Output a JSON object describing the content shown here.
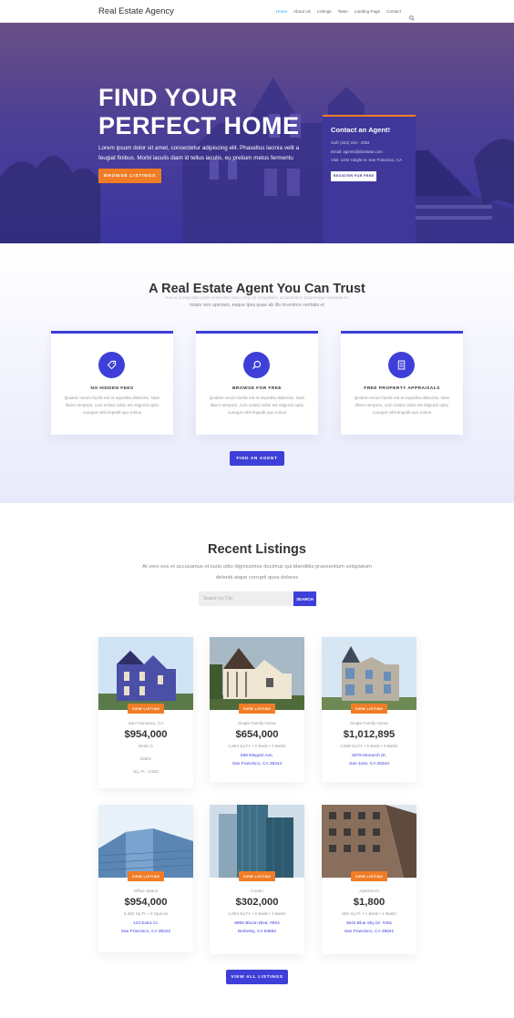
{
  "header": {
    "logo": "Real Estate Agency",
    "nav": [
      "Home",
      "About Us",
      "Listings",
      "Team",
      "Landing Page",
      "Contact"
    ],
    "search_icon": "search-icon"
  },
  "hero": {
    "title_line1": "FIND YOUR",
    "title_line2": "PERFECT HOME",
    "text": "Lorem ipsum dolor sit amet, consectetur adipiscing elit. Phasellus lacinia velit a feugiat finibus. Morbi iaculis diam id tellus iaculis, eu pretium metus fermentu",
    "button": "BROWSE LISTINGS",
    "contact": {
      "title": "Contact an Agent!",
      "call": "Call: (343) 234 - 2354",
      "email": "Email: agents@divistate.com",
      "visit": "Visit: 1234 Height st. San Francisco, CA",
      "button": "REGISTER FOR FREE"
    }
  },
  "agent": {
    "title": "A Real Estate Agent You Can Trust",
    "subtitle_line1": "Sed ut perspiciatis unde omnis iste natus error sit voluptatem accusantium doloremque laudantium,",
    "subtitle_line2": "totam rem aperiam, eaque ipsa quae ab illo inventore veritatis et",
    "features": [
      {
        "icon": "tag-icon",
        "title": "NO HIDDEN FEES",
        "text": "Quidem rerum facilis est et expedita distinctio. Nam libero tempore, cum soluta nobis est eligendi optio cumque nihil impedit quo minus"
      },
      {
        "icon": "search-icon",
        "title": "BROWSE FOR FREE",
        "text": "Quidem rerum facilis est et expedita distinctio. Nam libero tempore, cum soluta nobis est eligendi optio cumque nihil impedit quo minus"
      },
      {
        "icon": "document-icon",
        "title": "FREE PROPERTY APPRAISALS",
        "text": "Quidem rerum facilis est et expedita distinctio. Nam libero tempore, cum soluta nobis est eligendi optio cumque nihil impedit quo minus"
      }
    ],
    "button": "FIND AN AGENT"
  },
  "listings": {
    "title": "Recent Listings",
    "subtitle_line1": "At vero eos et accusamus et iusto odio dignissimos ducimus qui blanditiis praesentium voluptatum",
    "subtitle_line2": "deleniti atque corrupti quos dolores",
    "search_placeholder": "Search by City",
    "search_button": "SEARCH",
    "view_listing": "VIEW LISTING",
    "items": [
      {
        "type": "San Francisco, CA",
        "price": "$954,000",
        "meta": "Beds: 5",
        "meta2": "Baths",
        "meta3": "Sq. Ft.: 2,503",
        "addr1": "",
        "addr2": ""
      },
      {
        "type": "Single Family Home",
        "price": "$654,000",
        "meta": "1,654 Sq Ft.  •  2 Beds  •  2 Baths",
        "addr1": "568 Elegant Ave.",
        "addr2": "San Francisco, CA 39244"
      },
      {
        "type": "Single Family Home",
        "price": "$1,012,895",
        "meta": "2,938 Sq Ft.  •  5 Beds  •  4 Baths",
        "addr1": "6578 Monarch St.",
        "addr2": "San Jose, CA 28344"
      },
      {
        "type": "Office Space",
        "price": "$954,000",
        "meta": "5,452 Sq Ft.  •  3 Spaces",
        "addr1": "123 Extra Ct.",
        "addr2": "San Francisco, CA 39222"
      },
      {
        "type": "Condo",
        "price": "$302,000",
        "meta": "1,854 Sq Ft.  •  2 Beds  •  1 Baths",
        "addr1": "8965 Bloom Blvd. #604",
        "addr2": "Berkeley, CA 93882"
      },
      {
        "type": "Apartment",
        "price": "$1,800",
        "meta": "650 Sq Ft.  •  1 Beds  •  1 Baths",
        "addr1": "3542 Blue Sky Dr. #301",
        "addr2": "San Francisco, CA 39841"
      }
    ],
    "view_all": "VIEW ALL LISTINGS"
  },
  "colors": {
    "accent": "#3d3fd8",
    "orange": "#f07d26",
    "link": "#2ea3f2"
  }
}
